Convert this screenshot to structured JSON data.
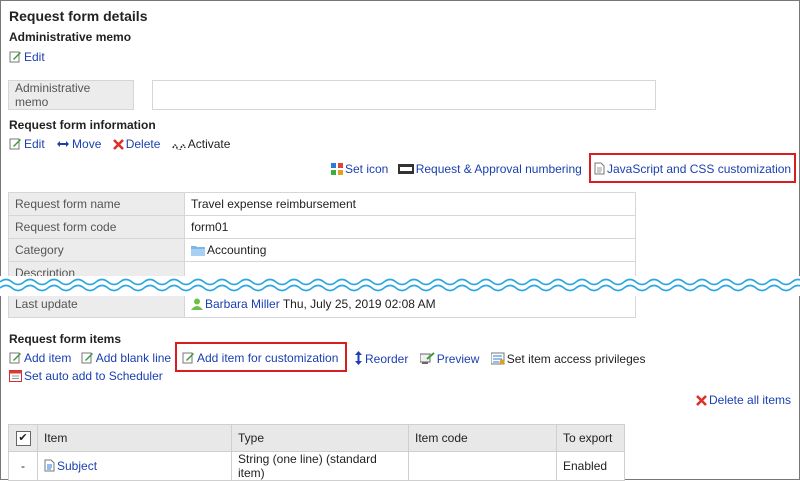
{
  "page": {
    "title": "Request form details"
  },
  "admin_memo": {
    "section_title": "Administrative memo",
    "edit_label": "Edit",
    "field_label": "Administrative memo",
    "field_value": ""
  },
  "info": {
    "section_title": "Request form information",
    "actions": {
      "edit": "Edit",
      "move": "Move",
      "delete": "Delete",
      "activate": "Activate"
    },
    "tools": {
      "set_icon": "Set icon",
      "numbering": "Request & Approval numbering",
      "customization": "JavaScript and CSS customization"
    },
    "rows": [
      {
        "label": "Request form name",
        "value": "Travel expense reimbursement"
      },
      {
        "label": "Request form code",
        "value": "form01"
      },
      {
        "label": "Category",
        "value": "Accounting"
      },
      {
        "label": "Description",
        "value": ""
      },
      {
        "label": "Last update",
        "user": "Barbara Miller",
        "value": "Thu, July 25, 2019 02:08 AM"
      }
    ]
  },
  "items": {
    "section_title": "Request form items",
    "actions": {
      "add_item": "Add item",
      "add_blank_line": "Add blank line",
      "add_custom": "Add item for customization",
      "reorder": "Reorder",
      "preview": "Preview",
      "access": "Set item access privileges",
      "scheduler": "Set auto add to Scheduler"
    },
    "delete_all": "Delete all items",
    "table": {
      "headers": {
        "check": "✔",
        "item": "Item",
        "type": "Type",
        "code": "Item code",
        "export": "To export"
      },
      "rows": [
        {
          "check": "-",
          "item": "Subject",
          "type": "String (one line) (standard item)",
          "code": "",
          "export": "Enabled"
        }
      ]
    }
  },
  "colors": {
    "link": "#1a3fb0",
    "highlight": "#d81e1e",
    "wave": "#2aa7e0"
  }
}
